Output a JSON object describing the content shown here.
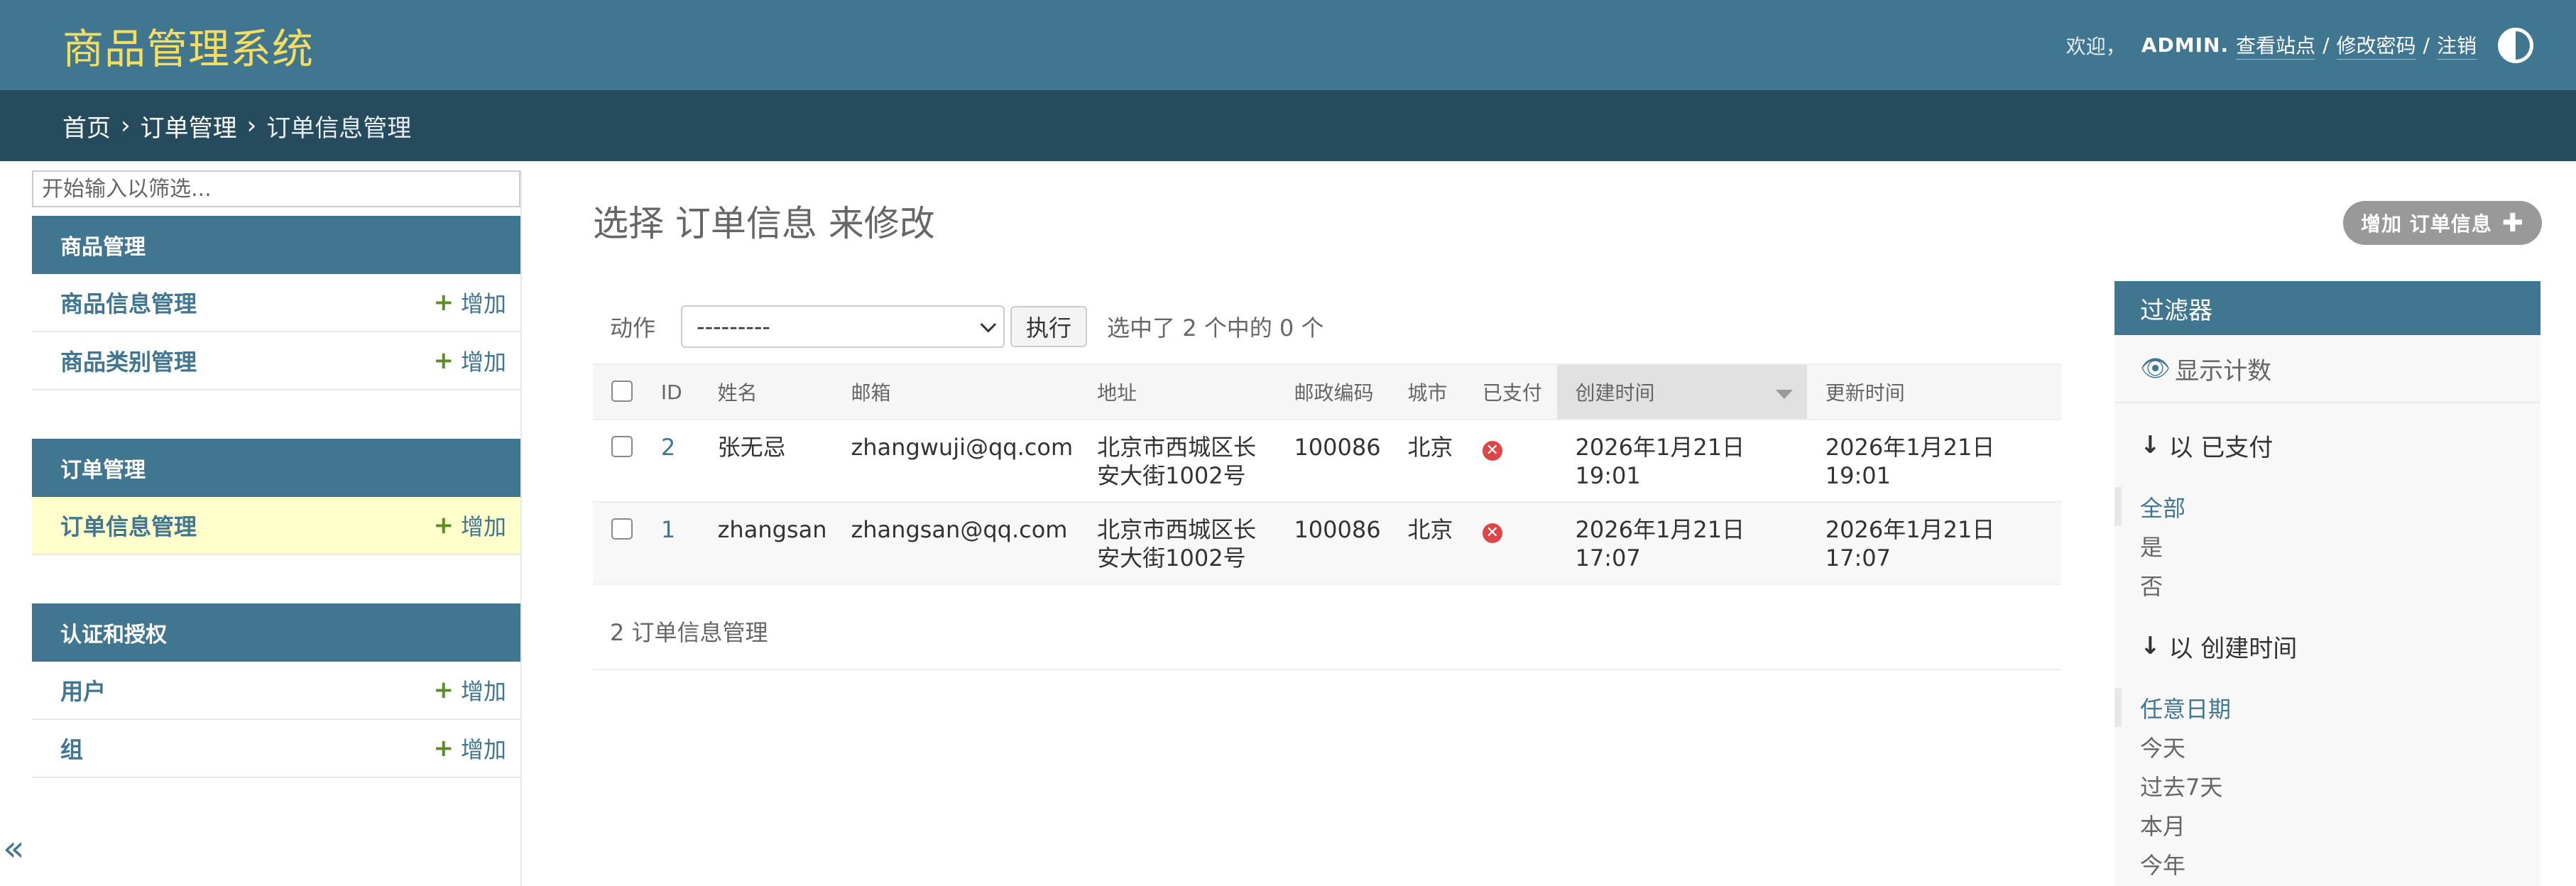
{
  "header": {
    "branding": "商品管理系统",
    "welcome": "欢迎，",
    "username": "ADMIN.",
    "links": [
      "查看站点",
      "修改密码",
      "注销"
    ],
    "separators": [
      "/",
      "/"
    ]
  },
  "breadcrumbs": {
    "items": [
      "首页",
      "订单管理",
      "订单信息管理"
    ],
    "separator": "›"
  },
  "sidebar": {
    "filter_placeholder": "开始输入以筛选...",
    "modules": [
      {
        "caption": "商品管理",
        "rows": [
          {
            "label": "商品信息管理",
            "add": "增加"
          },
          {
            "label": "商品类别管理",
            "add": "增加"
          }
        ]
      },
      {
        "caption": "订单管理",
        "rows": [
          {
            "label": "订单信息管理",
            "add": "增加"
          }
        ]
      },
      {
        "caption": "认证和授权",
        "rows": [
          {
            "label": "用户",
            "add": "增加"
          },
          {
            "label": "组",
            "add": "增加"
          }
        ]
      }
    ],
    "collapse_glyph": "«"
  },
  "content": {
    "title": "选择 订单信息 来修改",
    "add_button": "增加 订单信息",
    "actions": {
      "label": "动作",
      "select_value": "---------",
      "go": "执行",
      "counter": "选中了 2 个中的 0 个"
    },
    "table": {
      "headers": [
        "ID",
        "姓名",
        "邮箱",
        "地址",
        "邮政编码",
        "城市",
        "已支付",
        "创建时间",
        "更新时间"
      ],
      "rows": [
        {
          "id": "2",
          "name": "张无忌",
          "email": "zhangwuji@qq.com",
          "address_line1": "北京市西城区长",
          "address_line2": "安大街1002号",
          "postcode": "100086",
          "city": "北京",
          "paid": "✕",
          "created": "2026年1月21日 19:01",
          "updated": "2026年1月21日 19:01"
        },
        {
          "id": "1",
          "name": "zhangsan",
          "email": "zhangsan@qq.com",
          "address_line1": "北京市西城区长",
          "address_line2": "安大街1002号",
          "postcode": "100086",
          "city": "北京",
          "paid": "✕",
          "created": "2026年1月21日 17:07",
          "updated": "2026年1月21日 17:07"
        }
      ]
    },
    "paginator": "2 订单信息管理"
  },
  "filter": {
    "title": "过滤器",
    "show_counts": "显示计数",
    "groups": [
      {
        "heading": "以 已支付",
        "options": [
          "全部",
          "是",
          "否"
        ]
      },
      {
        "heading": "以 创建时间",
        "options": [
          "任意日期",
          "今天",
          "过去7天",
          "本月",
          "今年"
        ]
      }
    ]
  },
  "colors": {
    "header_bg": "#417690",
    "breadcrumb_bg": "#264b5d",
    "branding": "#f5dd5d",
    "link": "#417690",
    "active_row": "#ffffcc",
    "add_green": "#5b8c26",
    "error_red": "#dd4646"
  }
}
